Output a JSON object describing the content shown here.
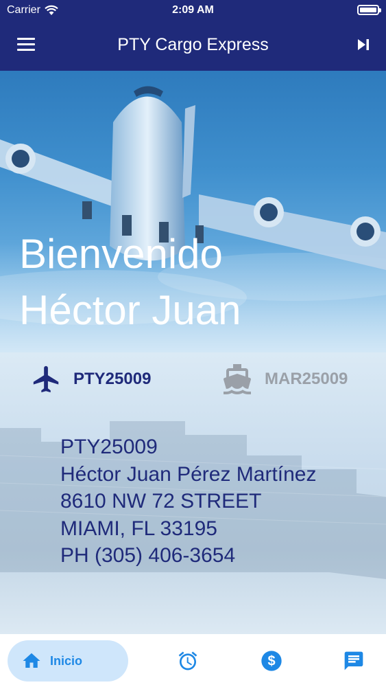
{
  "status_bar": {
    "carrier": "Carrier",
    "time": "2:09 AM"
  },
  "app_bar": {
    "title": "PTY Cargo Express"
  },
  "hero": {
    "welcome_line1": "Bienvenido",
    "welcome_line2": "Héctor Juan"
  },
  "tabs": [
    {
      "label": "PTY25009",
      "icon": "airplane-icon",
      "selected": true
    },
    {
      "label": "MAR25009",
      "icon": "ship-icon",
      "selected": false
    }
  ],
  "address": {
    "code": "PTY25009",
    "name": "Héctor Juan Pérez Martínez",
    "street": "8610 NW 72 STREET",
    "city": "MIAMI, FL 33195",
    "phone": "PH (305) 406-3654"
  },
  "bottom_nav": [
    {
      "label": "Inicio",
      "icon": "home-icon",
      "active": true
    },
    {
      "label": "",
      "icon": "alarm-clock-icon",
      "active": false
    },
    {
      "label": "",
      "icon": "dollar-icon",
      "active": false
    },
    {
      "label": "",
      "icon": "chat-icon",
      "active": false
    }
  ],
  "colors": {
    "navy": "#1f2a7a",
    "accent_blue": "#1e88e5",
    "inactive_gray": "#9aa0a8"
  }
}
